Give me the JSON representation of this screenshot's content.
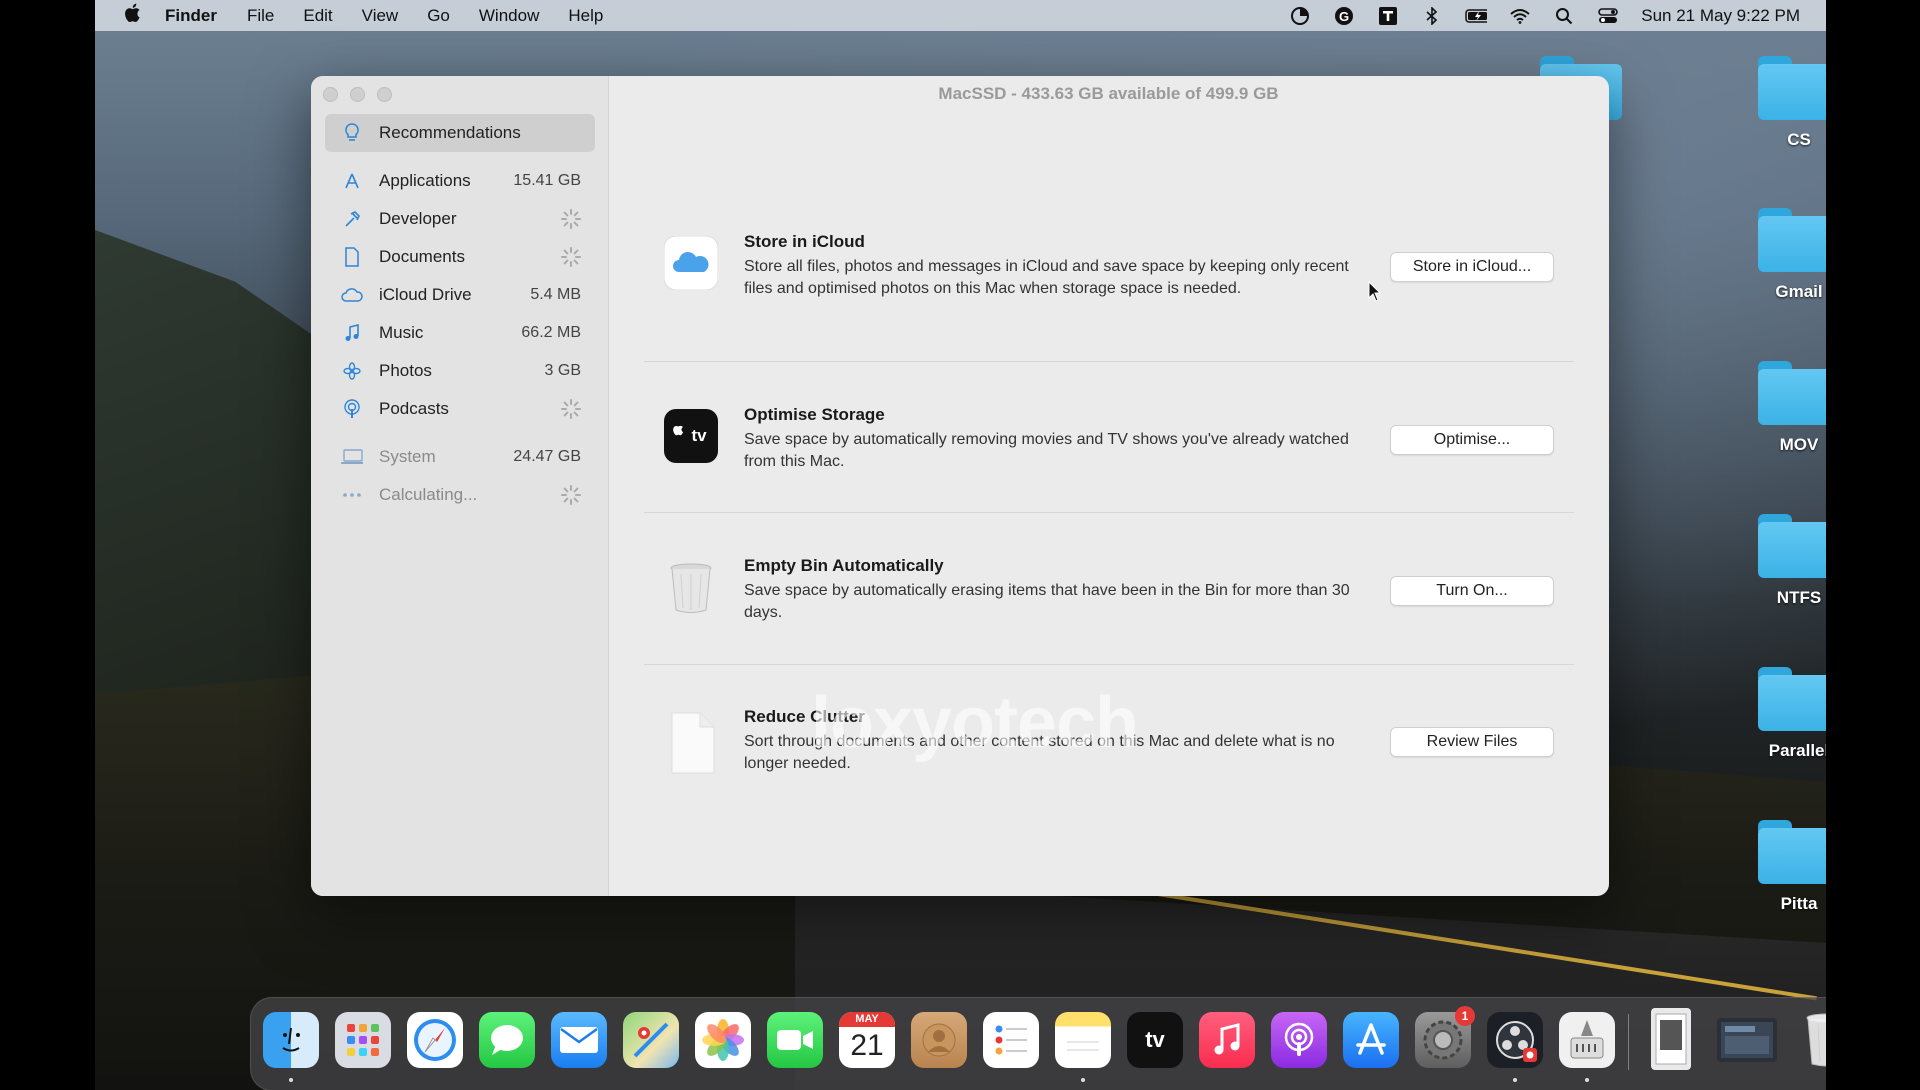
{
  "menubar": {
    "app_name": "Finder",
    "menus": [
      "File",
      "Edit",
      "View",
      "Go",
      "Window",
      "Help"
    ],
    "clock": "Sun 21 May  9:22 PM"
  },
  "window": {
    "title": "MacSSD - 433.63 GB available of 499.9 GB"
  },
  "sidebar": {
    "items": [
      {
        "label": "Recommendations",
        "size": "",
        "icon": "lightbulb-icon"
      },
      {
        "label": "Applications",
        "size": "15.41 GB",
        "icon": "app-store-icon"
      },
      {
        "label": "Developer",
        "size": "",
        "icon": "hammer-icon"
      },
      {
        "label": "Documents",
        "size": "",
        "icon": "document-icon"
      },
      {
        "label": "iCloud Drive",
        "size": "5.4 MB",
        "icon": "cloud-icon"
      },
      {
        "label": "Music",
        "size": "66.2 MB",
        "icon": "music-note-icon"
      },
      {
        "label": "Photos",
        "size": "3 GB",
        "icon": "photos-flower-icon"
      },
      {
        "label": "Podcasts",
        "size": "",
        "icon": "podcast-icon"
      },
      {
        "label": "System",
        "size": "24.47 GB",
        "icon": "laptop-icon"
      },
      {
        "label": "Calculating...",
        "size": "",
        "icon": "ellipsis-icon"
      }
    ]
  },
  "recommendations": [
    {
      "title": "Store in iCloud",
      "description": "Store all files, photos and messages in iCloud and save space by keeping only recent files and optimised photos on this Mac when storage space is needed.",
      "button": "Store in iCloud..."
    },
    {
      "title": "Optimise Storage",
      "description": "Save space by automatically removing movies and TV shows you've already watched from this Mac.",
      "button": "Optimise..."
    },
    {
      "title": "Empty Bin Automatically",
      "description": "Save space by automatically erasing items that have been in the Bin for more than 30 days.",
      "button": "Turn On..."
    },
    {
      "title": "Reduce Clutter",
      "description": "Sort through documents and other content stored on this Mac and delete what is no longer needed.",
      "button": "Review Files"
    }
  ],
  "appletv_label": "tv",
  "watermark": "loxyotech",
  "desktop_folders": [
    "CS",
    "Gmail",
    "MOV",
    "NTFS",
    "Parallel",
    "Pitta"
  ],
  "dock": {
    "calendar_month": "MAY",
    "calendar_day": "21",
    "tv_label": "tv",
    "settings_badge": "1"
  },
  "colors": {
    "folder": "#3bb2e6",
    "accent": "#1e88e5",
    "badge": "#e53935"
  }
}
